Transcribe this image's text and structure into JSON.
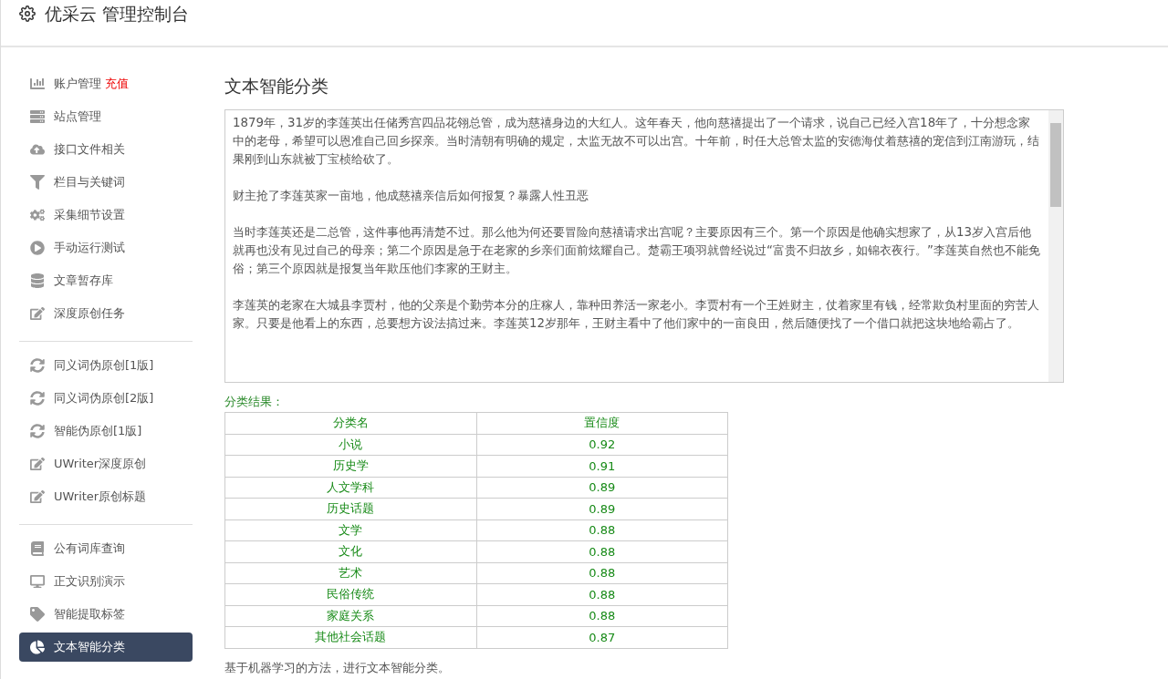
{
  "header": {
    "title": "优采云 管理控制台"
  },
  "sidebar": {
    "groups": [
      {
        "items": [
          {
            "kind": "chart",
            "label": "账户管理",
            "badge": "充值",
            "selected": false
          },
          {
            "kind": "server",
            "label": "站点管理",
            "selected": false
          },
          {
            "kind": "cloud",
            "label": "接口文件相关",
            "selected": false
          },
          {
            "kind": "filter",
            "label": "栏目与关键词",
            "selected": false
          },
          {
            "kind": "cogs",
            "label": "采集细节设置",
            "selected": false
          },
          {
            "kind": "play",
            "label": "手动运行测试",
            "selected": false
          },
          {
            "kind": "db",
            "label": "文章暂存库",
            "selected": false
          },
          {
            "kind": "edit",
            "label": "深度原创任务",
            "selected": false
          }
        ]
      },
      {
        "items": [
          {
            "kind": "sync",
            "label": "同义词伪原创[1版]",
            "selected": false
          },
          {
            "kind": "sync",
            "label": "同义词伪原创[2版]",
            "selected": false
          },
          {
            "kind": "sync",
            "label": "智能伪原创[1版]",
            "selected": false
          },
          {
            "kind": "edit",
            "label": "UWriter深度原创",
            "selected": false
          },
          {
            "kind": "edit",
            "label": "UWriter原创标题",
            "selected": false
          }
        ]
      },
      {
        "items": [
          {
            "kind": "book",
            "label": "公有词库查询",
            "selected": false
          },
          {
            "kind": "desktop",
            "label": "正文识别演示",
            "selected": false
          },
          {
            "kind": "tag",
            "label": "智能提取标签",
            "selected": false
          },
          {
            "kind": "pie",
            "label": "文本智能分类",
            "selected": true
          }
        ]
      }
    ]
  },
  "main": {
    "title": "文本智能分类",
    "paragraphs": [
      "1879年，31岁的李莲英出任储秀宫四品花翎总管，成为慈禧身边的大红人。这年春天，他向慈禧提出了一个请求，说自己已经入宫18年了，十分想念家中的老母，希望可以恩准自己回乡探亲。当时清朝有明确的规定，太监无故不可以出宫。十年前，时任大总管太监的安德海仗着慈禧的宠信到江南游玩，结果刚到山东就被丁宝桢给砍了。",
      "财主抢了李莲英家一亩地，他成慈禧亲信后如何报复？暴露人性丑恶",
      "当时李莲英还是二总管，这件事他再清楚不过。那么他为何还要冒险向慈禧请求出宫呢？主要原因有三个。第一个原因是他确实想家了，从13岁入宫后他就再也没有见过自己的母亲；第二个原因是急于在老家的乡亲们面前炫耀自己。楚霸王项羽就曾经说过“富贵不归故乡，如锦衣夜行。”李莲英自然也不能免俗；第三个原因就是报复当年欺压他们李家的王财主。",
      "李莲英的老家在大城县李贾村，他的父亲是个勤劳本分的庄稼人，靠种田养活一家老小。李贾村有一个王姓财主，仗着家里有钱，经常欺负村里面的穷苦人家。只要是他看上的东西，总要想方设法搞过来。李莲英12岁那年，王财主看中了他们家中的一亩良田，然后随便找了一个借口就把这块地给霸占了。"
    ],
    "result_label": "分类结果：",
    "columns": [
      "分类名",
      "置信度"
    ],
    "rows": [
      [
        "小说",
        "0.92"
      ],
      [
        "历史学",
        "0.91"
      ],
      [
        "人文学科",
        "0.89"
      ],
      [
        "历史话题",
        "0.89"
      ],
      [
        "文学",
        "0.88"
      ],
      [
        "文化",
        "0.88"
      ],
      [
        "艺术",
        "0.88"
      ],
      [
        "民俗传统",
        "0.88"
      ],
      [
        "家庭关系",
        "0.88"
      ],
      [
        "其他社会话题",
        "0.87"
      ]
    ],
    "note": "基于机器学习的方法，进行文本智能分类。"
  }
}
